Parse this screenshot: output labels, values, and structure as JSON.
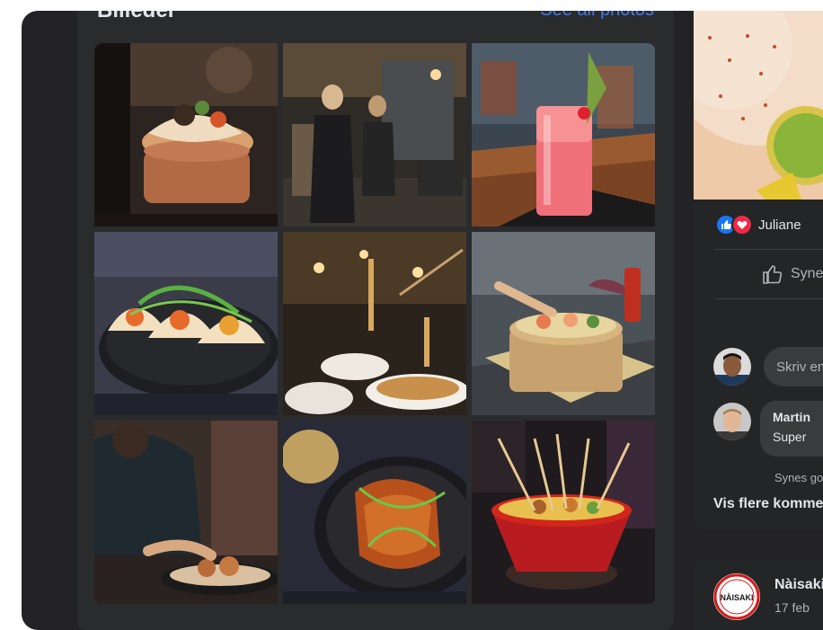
{
  "photos": {
    "title": "Billeder",
    "see_all": "See all photos",
    "items": [
      {
        "alt": "Gua bao bun in bamboo steamer"
      },
      {
        "alt": "Chefs working in restaurant kitchen"
      },
      {
        "alt": "Pink cocktail on wooden bar"
      },
      {
        "alt": "Tacos with herbs on black plate"
      },
      {
        "alt": "Noodles lifted with chopsticks"
      },
      {
        "alt": "Poke bowl in bamboo steamer"
      },
      {
        "alt": "Chef plating a dish"
      },
      {
        "alt": "Glazed chicken with scallions"
      },
      {
        "alt": "Skewers in red bowl"
      }
    ]
  },
  "post": {
    "reaction_names": "Juliane",
    "like_label": "Synes godt om",
    "comment_placeholder": "Skriv en kommentar...",
    "comment": {
      "author": "Martin",
      "text": "Super",
      "action": "Synes godt om"
    },
    "more_comments": "Vis flere kommentarer"
  },
  "post2": {
    "page_name": "Nàisaki",
    "date": "17 feb"
  },
  "logo_text": "NÀISAKI",
  "colors": {
    "background": "#232325",
    "card": "#242526",
    "accent": "#3d7bf0",
    "like_blue": "#1877f2",
    "love_red": "#f02849"
  }
}
